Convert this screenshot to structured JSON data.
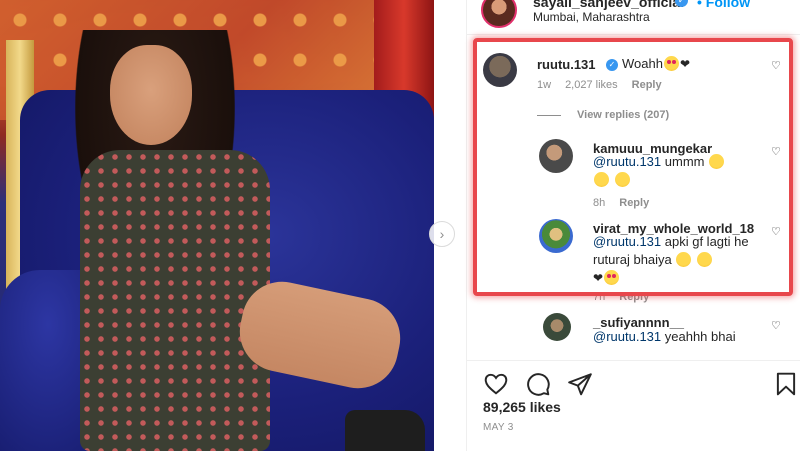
{
  "post": {
    "username": "sayali_sanjeev_official",
    "follow_label": "Follow",
    "location": "Mumbai, Maharashtra",
    "likes": "89,265 likes",
    "date": "MAY 3"
  },
  "comments": [
    {
      "username": "ruutu.131",
      "verified": true,
      "text": "Woahh",
      "age": "1w",
      "likes": "2,027 likes",
      "reply_label": "Reply",
      "view_replies": "View replies (207)"
    },
    {
      "username": "kamuuu_mungekar",
      "mention": "@ruutu.131",
      "text": "ummm",
      "age": "8h",
      "reply_label": "Reply"
    },
    {
      "username": "virat_my_whole_world_18",
      "mention": "@ruutu.131",
      "text": "apki gf lagti he ruturaj bhaiya",
      "age": "7h",
      "reply_label": "Reply"
    },
    {
      "username": "_sufiyannnn__",
      "mention": "@ruutu.131",
      "text": "yeahhh bhai"
    }
  ],
  "colors": {
    "highlight": "#e8474c",
    "link": "#0095f6",
    "mention": "#00376b",
    "verified": "#3897f0"
  },
  "icons": [
    "verified-badge-icon",
    "next-arrow-icon",
    "heart-icon",
    "comment-icon",
    "share-icon",
    "bookmark-icon"
  ]
}
